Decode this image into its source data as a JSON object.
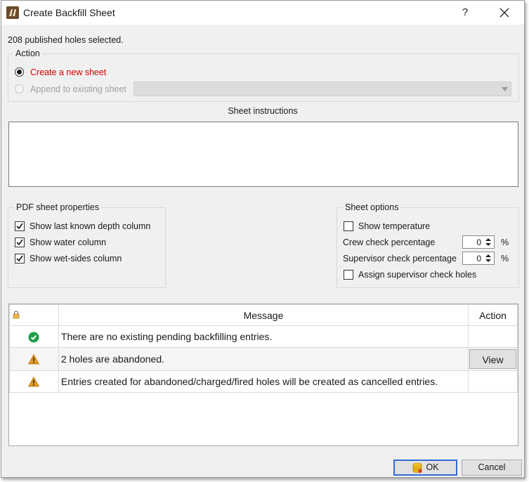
{
  "window": {
    "title": "Create Backfill Sheet",
    "help": "?",
    "close": "✕"
  },
  "selection_text": "208 published holes selected.",
  "action": {
    "legend": "Action",
    "create_label": "Create a new sheet",
    "append_label": "Append to existing sheet",
    "selected": "create"
  },
  "instructions": {
    "label": "Sheet instructions",
    "value": ""
  },
  "pdf_props": {
    "legend": "PDF sheet properties",
    "items": [
      {
        "label": "Show last known depth column",
        "checked": true
      },
      {
        "label": "Show water column",
        "checked": true
      },
      {
        "label": "Show wet-sides column",
        "checked": true
      }
    ]
  },
  "sheet_options": {
    "legend": "Sheet options",
    "show_temperature": {
      "label": "Show temperature",
      "checked": false
    },
    "crew_check": {
      "label": "Crew check percentage",
      "value": "0",
      "unit": "%"
    },
    "supervisor_check": {
      "label": "Supervisor check percentage",
      "value": "0",
      "unit": "%"
    },
    "assign_supervisor": {
      "label": "Assign supervisor check holes",
      "checked": false
    }
  },
  "messages": {
    "headers": {
      "lock": "lock-icon",
      "message": "Message",
      "action": "Action"
    },
    "rows": [
      {
        "icon": "check-circle-icon",
        "text": "There are no existing pending backfilling entries.",
        "action": ""
      },
      {
        "icon": "warning-icon",
        "text": "2 holes are abandoned.",
        "action": "View"
      },
      {
        "icon": "warning-icon",
        "text": "Entries created for abandoned/charged/fired holes will be created as cancelled entries.",
        "action": ""
      }
    ]
  },
  "footer": {
    "ok_label": "OK",
    "cancel_label": "Cancel"
  },
  "colors": {
    "accent": "#2f6cd4",
    "create_text": "#d40000",
    "success": "#1f9d45",
    "warning": "#e89b1c"
  }
}
